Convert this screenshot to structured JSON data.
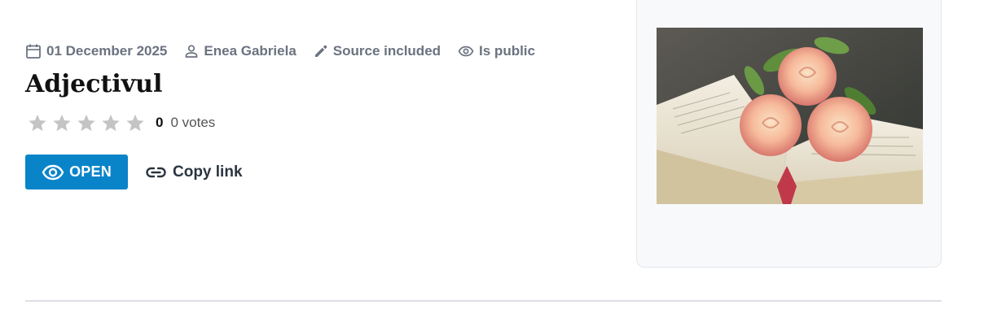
{
  "meta": {
    "date": "01 December 2025",
    "author": "Enea Gabriela",
    "source": "Source included",
    "visibility": "Is public"
  },
  "title": "Adjectivul",
  "rating": {
    "stars_total": 5,
    "stars_filled": 0,
    "value": "0",
    "votes": "0 votes"
  },
  "actions": {
    "open_label": "OPEN",
    "copy_label": "Copy link"
  },
  "icons": {
    "date": "calendar-icon",
    "author": "person-icon",
    "source": "pencil-icon",
    "visibility": "eye-icon",
    "open": "eye-icon",
    "copy": "link-icon",
    "star": "star-icon"
  },
  "colors": {
    "accent": "#0a84c9",
    "meta_text": "#6b7280",
    "star_empty": "#c4c4c4"
  }
}
